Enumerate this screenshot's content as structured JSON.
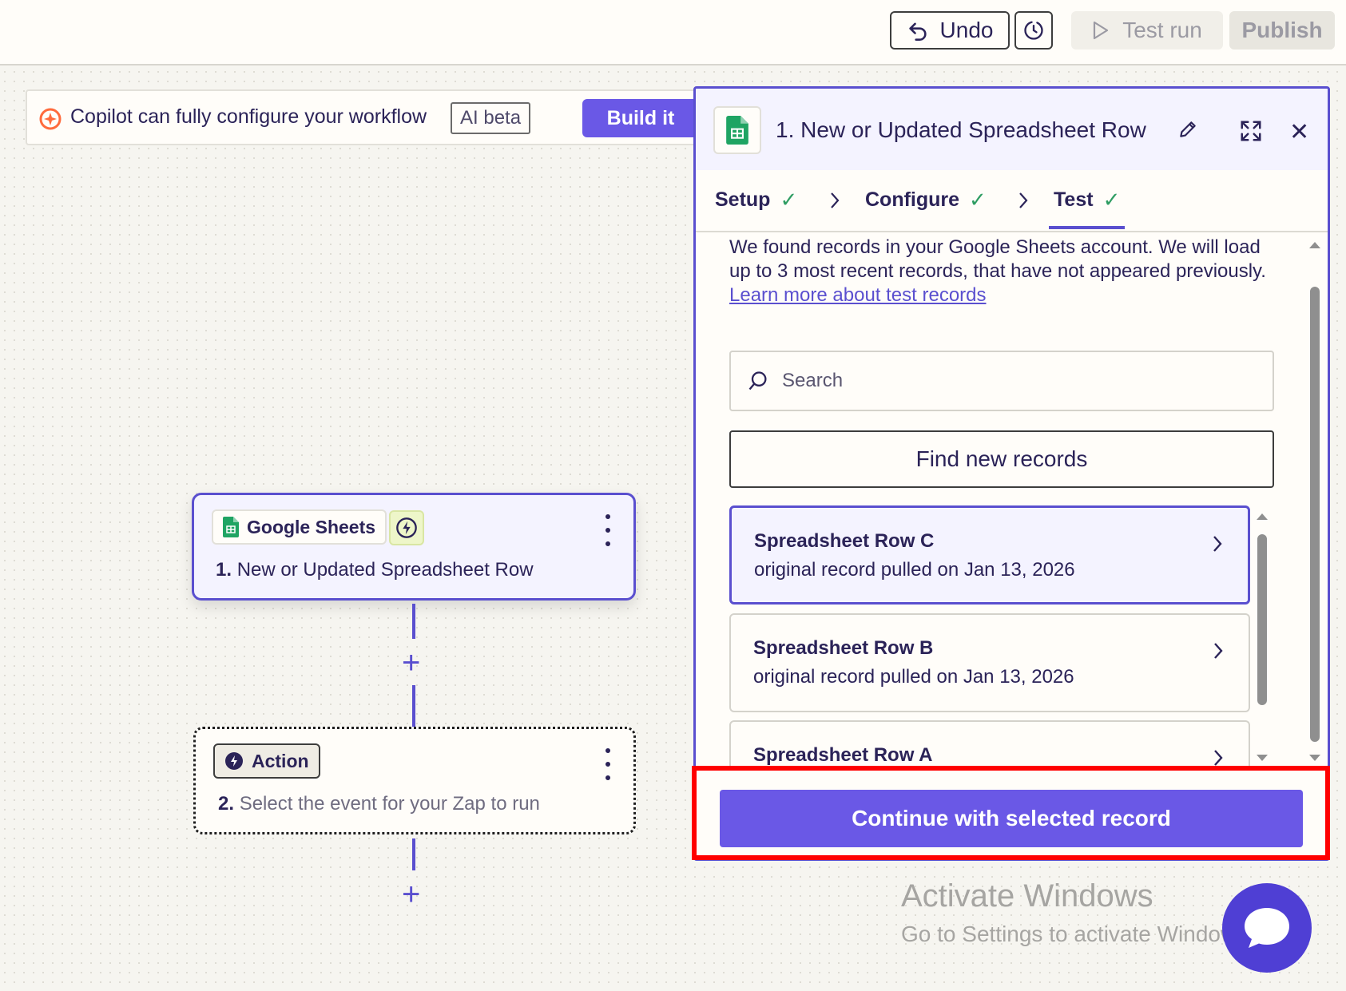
{
  "toolbar": {
    "undo_label": "Undo",
    "history_icon": "timer-icon",
    "test_run_label": "Test run",
    "publish_label": "Publish"
  },
  "copilot": {
    "text": "Copilot can fully configure your workflow",
    "badge": "AI beta",
    "button_label": "Build it"
  },
  "canvas": {
    "trigger_node": {
      "app_name": "Google Sheets",
      "step_number": "1.",
      "title": "New or Updated Spreadsheet Row"
    },
    "action_node": {
      "badge_label": "Action",
      "step_number": "2.",
      "title": "Select the event for your Zap to run"
    }
  },
  "panel": {
    "title": "1. New or Updated Spreadsheet Row",
    "tabs": [
      {
        "label": "Setup",
        "complete": true
      },
      {
        "label": "Configure",
        "complete": true
      },
      {
        "label": "Test",
        "complete": true,
        "active": true
      }
    ],
    "description": "We found records in your Google Sheets account. We will load up to 3 most recent records, that have not appeared previously.",
    "learn_more_link": "Learn more about test records",
    "search_placeholder": "Search",
    "find_button_label": "Find new records",
    "records": [
      {
        "name": "Spreadsheet Row C",
        "subtitle": "original record pulled on Jan 13, 2026",
        "selected": true
      },
      {
        "name": "Spreadsheet Row B",
        "subtitle": "original record pulled on Jan 13, 2026",
        "selected": false
      },
      {
        "name": "Spreadsheet Row A",
        "subtitle": "",
        "selected": false
      }
    ],
    "continue_button_label": "Continue with selected record"
  },
  "watermark": {
    "title": "Activate Windows",
    "subtitle": "Go to Settings to activate Windows."
  },
  "colors": {
    "accent": "#6a58e6",
    "border_accent": "#5a4fcf",
    "highlight": "#ff0000",
    "success": "#2f9d63"
  }
}
